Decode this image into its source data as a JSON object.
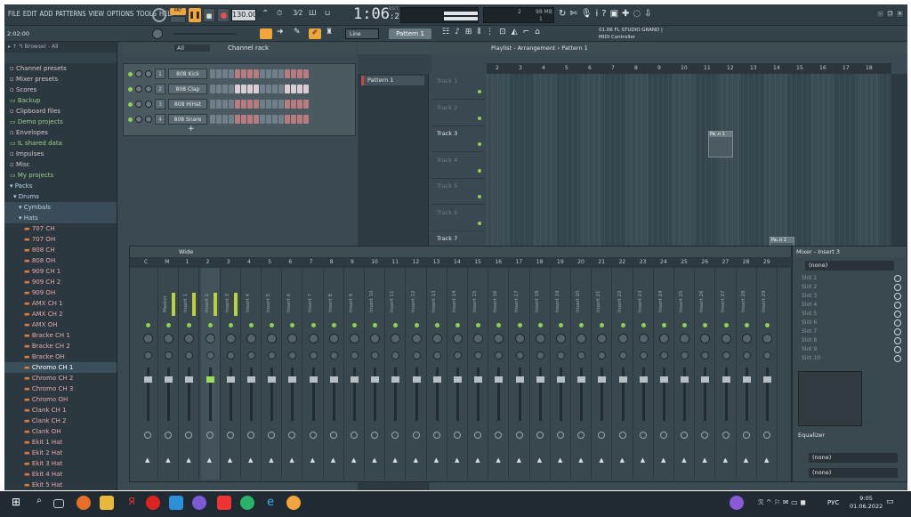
{
  "menu": [
    "FILE",
    "EDIT",
    "ADD",
    "PATTERNS",
    "VIEW",
    "OPTIONS",
    "TOOLS",
    "HELP"
  ],
  "transport": {
    "tempo": "130.000",
    "time": "1:06",
    "ticks": ":21",
    "bst": "B:S:T",
    "cpu_mb": "98 MB",
    "cpu_num": "2",
    "cpu_poly": "1",
    "hint_time": "2:02:00"
  },
  "toolbar2": {
    "snap": "Line",
    "pattern": "Pattern 1",
    "news_title": "01.06 FL STUDIO GRAND |",
    "news_sub": "MIDI Controller"
  },
  "browser": {
    "header": "Browser - All",
    "items": [
      {
        "label": "Channel presets",
        "type": "plain"
      },
      {
        "label": "Mixer presets",
        "type": "plain"
      },
      {
        "label": "Scores",
        "type": "plain"
      },
      {
        "label": "Backup",
        "type": "folder"
      },
      {
        "label": "Clipboard files",
        "type": "plain"
      },
      {
        "label": "Demo projects",
        "type": "folder"
      },
      {
        "label": "Envelopes",
        "type": "plain"
      },
      {
        "label": "IL shared data",
        "type": "folder"
      },
      {
        "label": "Impulses",
        "type": "plain"
      },
      {
        "label": "Misc",
        "type": "plain"
      },
      {
        "label": "My projects",
        "type": "folder"
      },
      {
        "label": "Packs",
        "type": "open"
      },
      {
        "label": "Drums",
        "type": "open"
      },
      {
        "label": "Cymbals",
        "type": "open"
      },
      {
        "label": "Hats",
        "type": "open"
      },
      {
        "label": "707 CH",
        "type": "file"
      },
      {
        "label": "707 OH",
        "type": "file"
      },
      {
        "label": "808 CH",
        "type": "file"
      },
      {
        "label": "808 OH",
        "type": "file"
      },
      {
        "label": "909 CH 1",
        "type": "file"
      },
      {
        "label": "909 CH 2",
        "type": "file"
      },
      {
        "label": "909 OH",
        "type": "file"
      },
      {
        "label": "AMX CH 1",
        "type": "file"
      },
      {
        "label": "AMX CH 2",
        "type": "file"
      },
      {
        "label": "AMX OH",
        "type": "file"
      },
      {
        "label": "Bracke CH 1",
        "type": "file"
      },
      {
        "label": "Bracke CH 2",
        "type": "file"
      },
      {
        "label": "Bracke OH",
        "type": "file"
      },
      {
        "label": "Chromo CH 1",
        "type": "sel"
      },
      {
        "label": "Chromo CH 2",
        "type": "file"
      },
      {
        "label": "Chromo CH 3",
        "type": "file"
      },
      {
        "label": "Chromo OH",
        "type": "file"
      },
      {
        "label": "Clank CH 1",
        "type": "file"
      },
      {
        "label": "Clank CH 2",
        "type": "file"
      },
      {
        "label": "Clank OH",
        "type": "file"
      },
      {
        "label": "Ekit 1 Hat",
        "type": "file"
      },
      {
        "label": "Ekit 2 Hat",
        "type": "file"
      },
      {
        "label": "Ekit 3 Hat",
        "type": "file"
      },
      {
        "label": "Ekit 4 Hat",
        "type": "file"
      },
      {
        "label": "Ekit 5 Hat",
        "type": "file"
      },
      {
        "label": "Ekit 6 Hat",
        "type": "file"
      }
    ]
  },
  "channel_rack": {
    "title": "Channel rack",
    "filter": "All",
    "channels": [
      {
        "num": "1",
        "name": "808 Kick"
      },
      {
        "num": "2",
        "name": "808 Clap"
      },
      {
        "num": "3",
        "name": "808 HiHat"
      },
      {
        "num": "4",
        "name": "808 Snare"
      }
    ]
  },
  "patterns": {
    "items": [
      "Pattern 1"
    ]
  },
  "playlist": {
    "title": "Playlist - Arrangement",
    "pattern": "Pattern 1",
    "bars": [
      "2",
      "3",
      "4",
      "5",
      "6",
      "7",
      "8",
      "9",
      "10",
      "11",
      "12",
      "13",
      "14",
      "15",
      "16",
      "17",
      "18"
    ],
    "tracks": [
      "Track 1",
      "Track 2",
      "Track 3",
      "Track 4",
      "Track 5",
      "Track 6",
      "Track 7"
    ],
    "clip_label": "Pa..n 1"
  },
  "mixer": {
    "title": "Wide",
    "master": "Master",
    "inserts": [
      "Insert 1",
      "Insert 2",
      "Insert 3",
      "Insert 4",
      "Insert 5",
      "Insert 6",
      "Insert 7",
      "Insert 8",
      "Insert 9",
      "Insert 10",
      "Insert 11",
      "Insert 12",
      "Insert 13",
      "Insert 14",
      "Insert 15",
      "Insert 16",
      "Insert 17",
      "Insert 18",
      "Insert 19",
      "Insert 20",
      "Insert 21",
      "Insert 22",
      "Insert 23",
      "Insert 24",
      "Insert 25",
      "Insert 26",
      "Insert 27",
      "Insert 28",
      "Insert 29",
      "Insert 30"
    ],
    "numbers": [
      "C",
      "M",
      "1",
      "2",
      "3",
      "4",
      "5",
      "6",
      "7",
      "8",
      "9",
      "10",
      "11",
      "12",
      "13",
      "14",
      "15",
      "16",
      "17",
      "18",
      "19",
      "20",
      "21",
      "22",
      "23",
      "24",
      "25",
      "26",
      "27",
      "28",
      "29"
    ]
  },
  "mixer_inspector": {
    "title": "Mixer - Insert 3",
    "preset": "(none)",
    "slots": [
      "Slot 1",
      "Slot 2",
      "Slot 3",
      "Slot 4",
      "Slot 5",
      "Slot 6",
      "Slot 7",
      "Slot 8",
      "Slot 9",
      "Slot 10"
    ],
    "eq": "Equalizer",
    "out1": "(none)",
    "out2": "(none)"
  },
  "taskbar": {
    "lang": "РУС",
    "time": "9:05",
    "date": "01.06.2022"
  }
}
